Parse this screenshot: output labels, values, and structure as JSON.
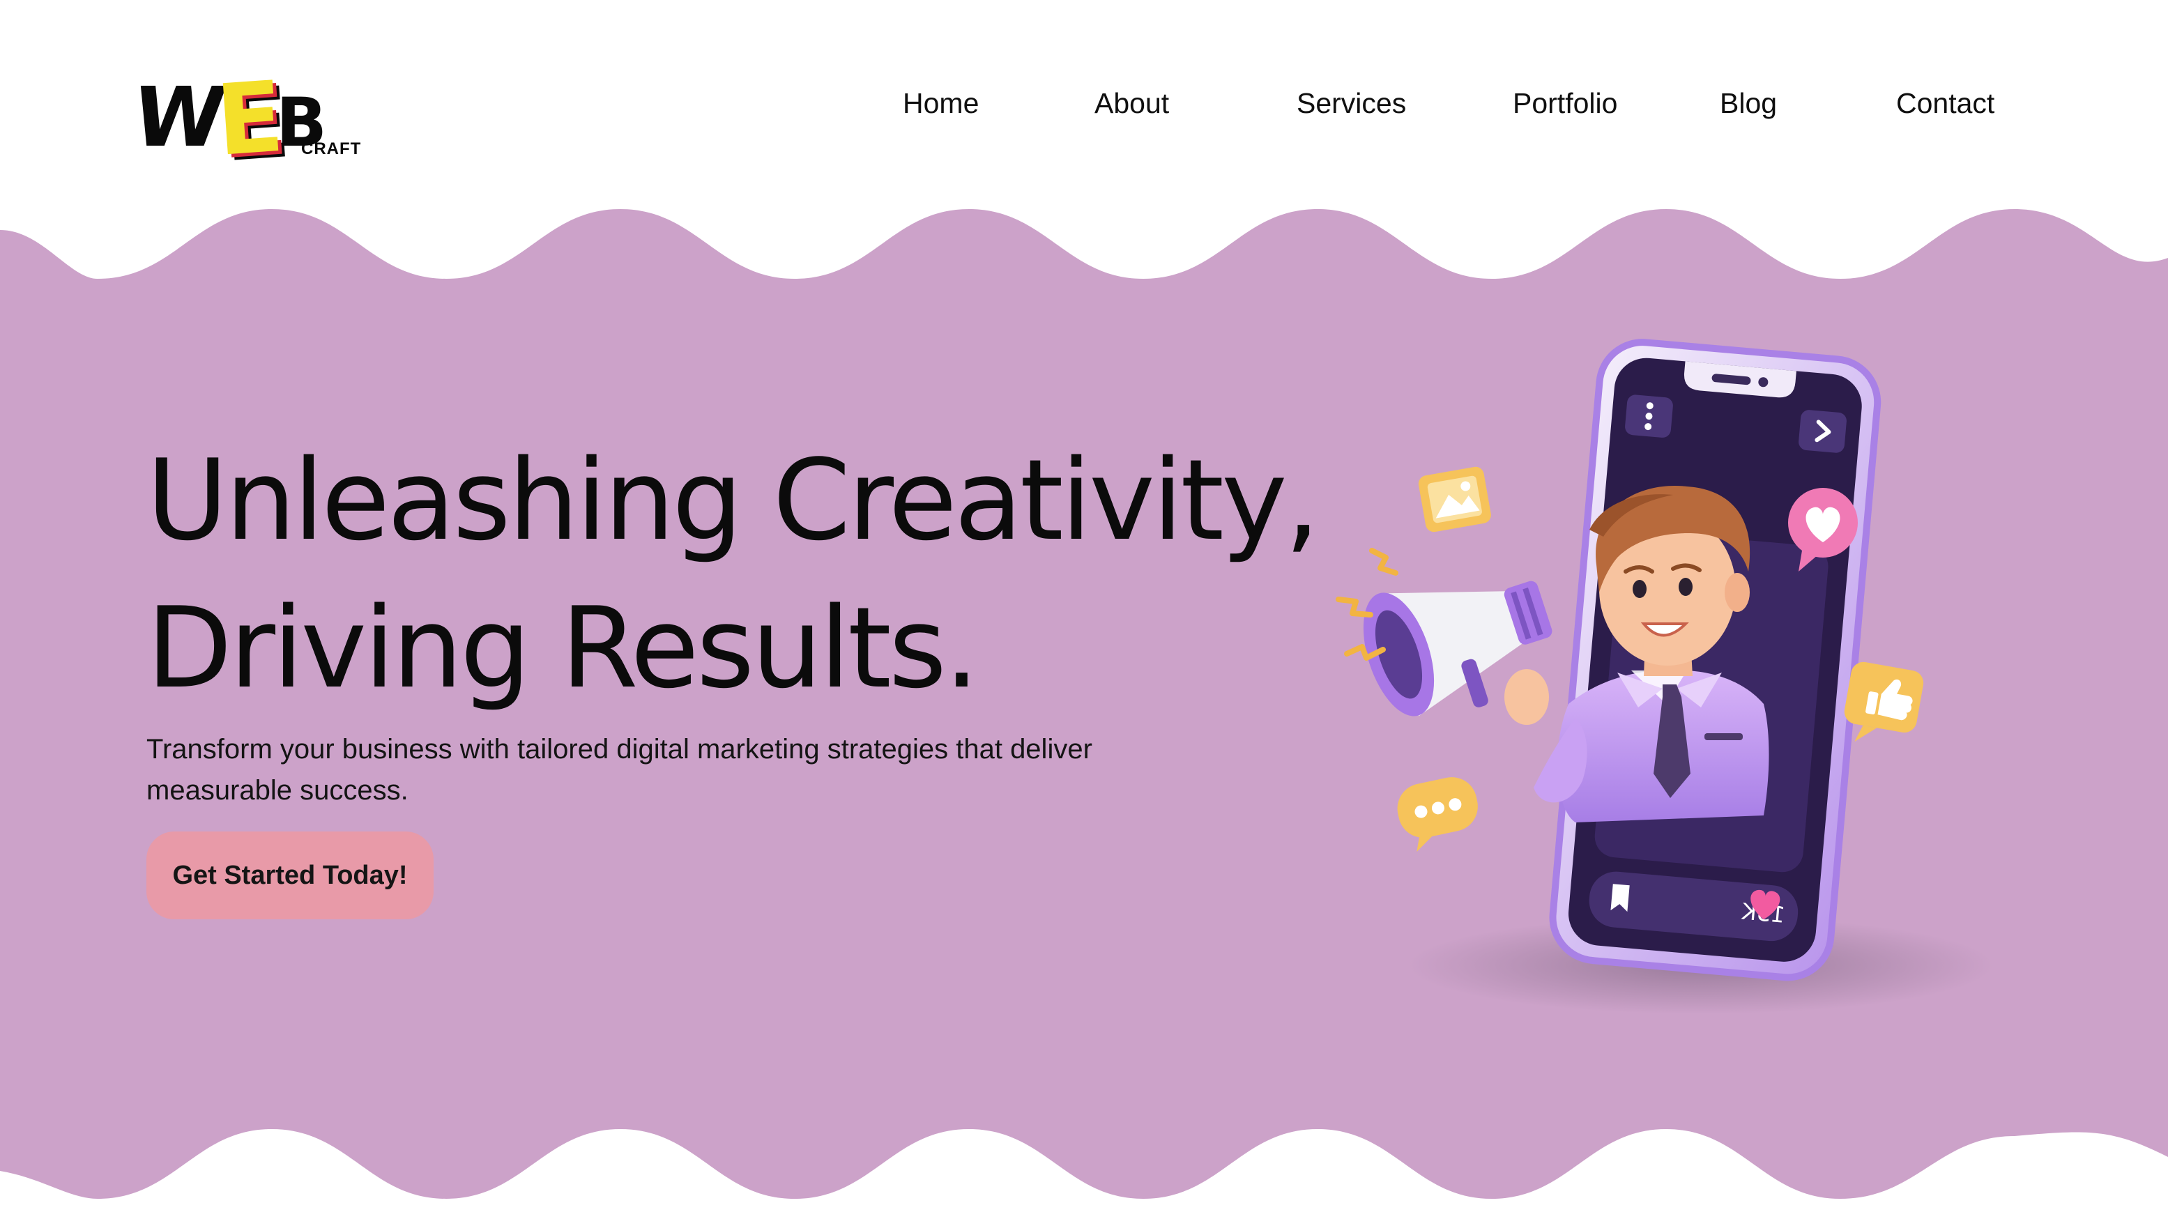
{
  "brand": {
    "logo_word": "WEB",
    "logo_sub": "CRAFT"
  },
  "nav": {
    "items": [
      {
        "label": "Home"
      },
      {
        "label": "About"
      },
      {
        "label": "Services"
      },
      {
        "label": "Portfolio"
      },
      {
        "label": "Blog"
      },
      {
        "label": "Contact"
      }
    ]
  },
  "hero": {
    "title_line1": "Unleashing Creativity,",
    "title_line2": "Driving Results.",
    "subtitle": "Transform your business with tailored digital marketing strategies that deliver measurable success.",
    "cta_label": "Get Started Today!"
  },
  "illustration": {
    "likes_count": "15K"
  },
  "colors": {
    "hero_background": "#cca2c9",
    "cta_background": "#e89aa8",
    "phone_screen": "#2b1c4a",
    "phone_frame": "#c7a6f0"
  }
}
